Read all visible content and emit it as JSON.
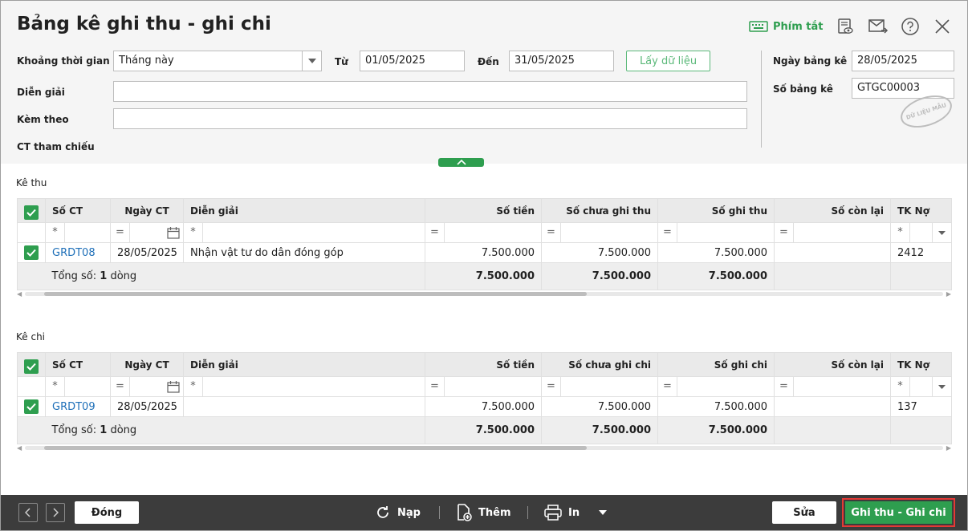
{
  "header": {
    "title": "Bảng kê ghi thu - ghi chi",
    "shortcut_label": "Phím tắt"
  },
  "form": {
    "period_label": "Khoảng thời gian",
    "period_value": "Tháng này",
    "from_label": "Từ",
    "from_value": "01/05/2025",
    "to_label": "Đến",
    "to_value": "31/05/2025",
    "fetch_label": "Lấy dữ liệu",
    "desc_label": "Diễn giải",
    "desc_value": "",
    "attach_label": "Kèm theo",
    "attach_value": "",
    "ref_label": "CT tham chiếu",
    "list_date_label": "Ngày bảng kê",
    "list_date_value": "28/05/2025",
    "list_no_label": "Số bảng kê",
    "list_no_value": "GTGC00003",
    "stamp": "DỮ LIỆU MẪU"
  },
  "receipts": {
    "title": "Kê thu",
    "columns": [
      "Số CT",
      "Ngày CT",
      "Diễn giải",
      "Số tiền",
      "Số chưa ghi thu",
      "Số ghi thu",
      "Số còn lại",
      "TK Nợ"
    ],
    "rows": [
      {
        "doc_no": "GRDT08",
        "date": "28/05/2025",
        "desc": "Nhận vật tư do dân đóng góp",
        "amount": "7.500.000",
        "unrecorded": "7.500.000",
        "recorded": "7.500.000",
        "remaining": "",
        "debit": "2412"
      }
    ],
    "total_label": "Tổng số:",
    "total_count": "1",
    "total_unit": "dòng",
    "total_amount": "7.500.000",
    "total_unrecorded": "7.500.000",
    "total_recorded": "7.500.000"
  },
  "expenses": {
    "title": "Kê chi",
    "columns": [
      "Số CT",
      "Ngày CT",
      "Diễn giải",
      "Số tiền",
      "Số chưa ghi chi",
      "Số ghi chi",
      "Số còn lại",
      "TK Nợ"
    ],
    "rows": [
      {
        "doc_no": "GRDT09",
        "date": "28/05/2025",
        "desc": "",
        "amount": "7.500.000",
        "unrecorded": "7.500.000",
        "recorded": "7.500.000",
        "remaining": "",
        "debit": "137"
      }
    ],
    "total_label": "Tổng số:",
    "total_count": "1",
    "total_unit": "dòng",
    "total_amount": "7.500.000",
    "total_unrecorded": "7.500.000",
    "total_recorded": "7.500.000"
  },
  "footer": {
    "close_label": "Đóng",
    "reload_label": "Nạp",
    "add_label": "Thêm",
    "print_label": "In",
    "edit_label": "Sửa",
    "primary_label": "Ghi thu - Ghi chi"
  },
  "filter_ops": {
    "star": "*",
    "eq": "="
  },
  "colors": {
    "accent": "#2e9e4f",
    "link": "#1e6fb8",
    "footer_bg": "#3c3c3c",
    "highlight_border": "#e53935"
  }
}
